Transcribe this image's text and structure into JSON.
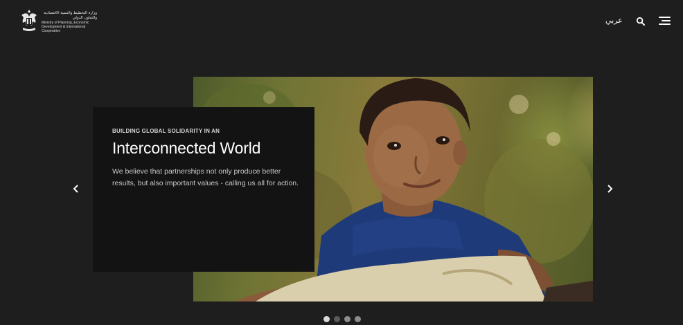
{
  "header": {
    "logo_arabic": "وزارة التخطيط والتنمية الاقتصادية والتعاون الدولي",
    "logo_english": "Ministry of Planning, Economic Development & International Cooperation",
    "lang_label": "عربي",
    "icons": {
      "search": "search-icon",
      "menu": "hamburger-menu-icon",
      "logo": "eagle-emblem-icon"
    }
  },
  "slide": {
    "kicker": "BUILDING GLOBAL SOLIDARITY IN AN",
    "title": "Interconnected World",
    "body": "We believe that partnerships not only produce better results, but also important values - calling us all for action."
  },
  "slider": {
    "icons": {
      "prev": "chevron-left-icon",
      "next": "chevron-right-icon"
    },
    "dot_count": 4,
    "active_dot": 1
  },
  "colors": {
    "background": "#1e1e1f",
    "caption_bg": "#131314",
    "text": "#ffffff"
  }
}
